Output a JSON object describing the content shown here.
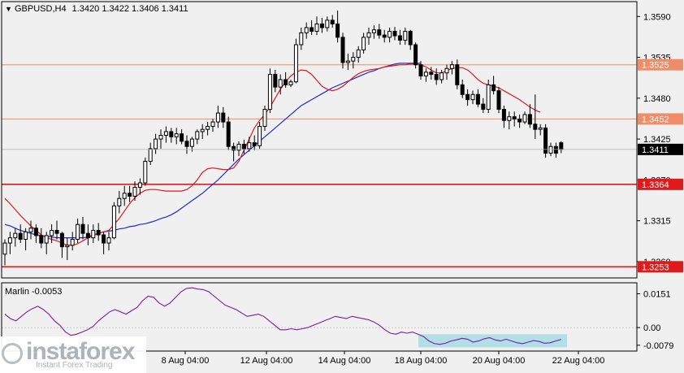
{
  "header": {
    "symbol": "GBPUSD,H4",
    "ohlc": "1.3420 1.3422 1.3406 1.3411"
  },
  "indicator": {
    "name": "Marlin",
    "value": "-0.0053",
    "ticks": [
      "0.0151",
      "0.00",
      "-0.0079"
    ]
  },
  "watermark": {
    "brand": "instaforex",
    "tagline": "Instant Forex Trading"
  },
  "colors": {
    "background": "#f0f0f0",
    "bull_candle": "#ffffff",
    "bear_candle": "#000000",
    "ma_fast": "#e0191e",
    "ma_slow": "#1f2ccc",
    "level_thin": "#f08c68",
    "level_thick": "#e01a1a",
    "price_tag": "#000000",
    "oscillator": "#7c1aa6",
    "highlight_box": "#a8dde4"
  },
  "chart_data": [
    {
      "type": "candlestick",
      "title": "GBPUSD,H4",
      "x_ticks": [
        "8 Aug 04:00",
        "12 Aug 04:00",
        "14 Aug 04:00",
        "18 Aug 04:00",
        "20 Aug 04:00",
        "22 Aug 04:00"
      ],
      "y_ticks": [
        1.359,
        1.3535,
        1.348,
        1.3425,
        1.337,
        1.3315,
        1.326
      ],
      "ylim": [
        1.3238,
        1.361
      ],
      "price_labels": [
        {
          "value": 1.3525,
          "text": "1.3525",
          "style": "thin"
        },
        {
          "value": 1.3452,
          "text": "1.3452",
          "style": "thin"
        },
        {
          "value": 1.3364,
          "text": "1.3364",
          "style": "thick"
        },
        {
          "value": 1.3253,
          "text": "1.3253",
          "style": "thick"
        }
      ],
      "current_price": {
        "value": 1.3411,
        "text": "1.3411"
      },
      "candles_ohlc": [
        [
          1.327,
          1.329,
          1.3255,
          1.3285
        ],
        [
          1.3285,
          1.33,
          1.327,
          1.3292
        ],
        [
          1.3292,
          1.3305,
          1.328,
          1.3298
        ],
        [
          1.3298,
          1.331,
          1.3285,
          1.329
        ],
        [
          1.329,
          1.3305,
          1.3275,
          1.33
        ],
        [
          1.33,
          1.3315,
          1.329,
          1.3305
        ],
        [
          1.3305,
          1.331,
          1.3285,
          1.3295
        ],
        [
          1.3295,
          1.3305,
          1.3278,
          1.3285
        ],
        [
          1.3285,
          1.33,
          1.327,
          1.3295
        ],
        [
          1.3295,
          1.331,
          1.3285,
          1.3302
        ],
        [
          1.3302,
          1.3315,
          1.329,
          1.3298
        ],
        [
          1.3298,
          1.33,
          1.3265,
          1.328
        ],
        [
          1.328,
          1.3292,
          1.3262,
          1.3282
        ],
        [
          1.3282,
          1.33,
          1.3275,
          1.329
        ],
        [
          1.329,
          1.3318,
          1.3285,
          1.331
        ],
        [
          1.331,
          1.332,
          1.329,
          1.3298
        ],
        [
          1.3298,
          1.331,
          1.3282,
          1.3292
        ],
        [
          1.3292,
          1.331,
          1.3285,
          1.3302
        ],
        [
          1.3302,
          1.3312,
          1.3288,
          1.3296
        ],
        [
          1.3296,
          1.33,
          1.327,
          1.3285
        ],
        [
          1.3285,
          1.33,
          1.3275,
          1.3292
        ],
        [
          1.3292,
          1.334,
          1.329,
          1.3335
        ],
        [
          1.3335,
          1.3355,
          1.3325,
          1.3345
        ],
        [
          1.3345,
          1.3362,
          1.3335,
          1.3352
        ],
        [
          1.3352,
          1.3362,
          1.334,
          1.3348
        ],
        [
          1.3348,
          1.3368,
          1.3342,
          1.336
        ],
        [
          1.336,
          1.3372,
          1.335,
          1.3366
        ],
        [
          1.3366,
          1.34,
          1.3362,
          1.3395
        ],
        [
          1.3395,
          1.342,
          1.339,
          1.3412
        ],
        [
          1.3412,
          1.3432,
          1.3405,
          1.3425
        ],
        [
          1.3425,
          1.3438,
          1.3412,
          1.343
        ],
        [
          1.343,
          1.3442,
          1.342,
          1.3435
        ],
        [
          1.3435,
          1.344,
          1.342,
          1.3428
        ],
        [
          1.3428,
          1.344,
          1.3418,
          1.3432
        ],
        [
          1.3432,
          1.3438,
          1.3418,
          1.3422
        ],
        [
          1.3422,
          1.343,
          1.3405,
          1.3415
        ],
        [
          1.3415,
          1.3428,
          1.3408,
          1.3425
        ],
        [
          1.3425,
          1.3438,
          1.3418,
          1.3435
        ],
        [
          1.3435,
          1.3445,
          1.3425,
          1.3438
        ],
        [
          1.3438,
          1.3448,
          1.343,
          1.3442
        ],
        [
          1.3442,
          1.3452,
          1.3435,
          1.3448
        ],
        [
          1.3448,
          1.347,
          1.344,
          1.346
        ],
        [
          1.346,
          1.3468,
          1.344,
          1.3448
        ],
        [
          1.3448,
          1.3455,
          1.341,
          1.3415
        ],
        [
          1.3415,
          1.342,
          1.3395,
          1.341
        ],
        [
          1.341,
          1.3422,
          1.3402,
          1.3418
        ],
        [
          1.3418,
          1.3424,
          1.3405,
          1.3412
        ],
        [
          1.3412,
          1.3428,
          1.3408,
          1.342
        ],
        [
          1.342,
          1.343,
          1.341,
          1.3416
        ],
        [
          1.3416,
          1.3448,
          1.3412,
          1.3442
        ],
        [
          1.3442,
          1.347,
          1.3436,
          1.3465
        ],
        [
          1.3465,
          1.352,
          1.346,
          1.3512
        ],
        [
          1.3512,
          1.3518,
          1.3488,
          1.3495
        ],
        [
          1.3495,
          1.3512,
          1.3485,
          1.3505
        ],
        [
          1.3505,
          1.3515,
          1.3494,
          1.3498
        ],
        [
          1.3498,
          1.3505,
          1.3495,
          1.3502
        ],
        [
          1.3502,
          1.356,
          1.35,
          1.3552
        ],
        [
          1.3552,
          1.3575,
          1.3545,
          1.3568
        ],
        [
          1.3568,
          1.3582,
          1.356,
          1.3575
        ],
        [
          1.3575,
          1.3585,
          1.3565,
          1.357
        ],
        [
          1.357,
          1.359,
          1.3565,
          1.358
        ],
        [
          1.358,
          1.3588,
          1.3568,
          1.3575
        ],
        [
          1.3575,
          1.359,
          1.357,
          1.3585
        ],
        [
          1.3585,
          1.3592,
          1.3575,
          1.358
        ],
        [
          1.358,
          1.3598,
          1.3555,
          1.3562
        ],
        [
          1.3562,
          1.3568,
          1.352,
          1.3528
        ],
        [
          1.3528,
          1.354,
          1.3518,
          1.353
        ],
        [
          1.353,
          1.3542,
          1.352,
          1.3535
        ],
        [
          1.3535,
          1.355,
          1.3528,
          1.3545
        ],
        [
          1.3545,
          1.3568,
          1.354,
          1.3562
        ],
        [
          1.3562,
          1.3575,
          1.3552,
          1.3568
        ],
        [
          1.3568,
          1.3578,
          1.356,
          1.3572
        ],
        [
          1.3572,
          1.358,
          1.356,
          1.3565
        ],
        [
          1.3565,
          1.3572,
          1.3555,
          1.3562
        ],
        [
          1.3562,
          1.3575,
          1.3555,
          1.357
        ],
        [
          1.357,
          1.3576,
          1.3558,
          1.3564
        ],
        [
          1.3564,
          1.3572,
          1.3552,
          1.3558
        ],
        [
          1.3558,
          1.3575,
          1.3552,
          1.357
        ],
        [
          1.357,
          1.3572,
          1.3545,
          1.3552
        ],
        [
          1.3552,
          1.3555,
          1.352,
          1.3525
        ],
        [
          1.3525,
          1.353,
          1.3505,
          1.351
        ],
        [
          1.351,
          1.352,
          1.3502,
          1.3515
        ],
        [
          1.3515,
          1.3522,
          1.3505,
          1.3512
        ],
        [
          1.3512,
          1.352,
          1.3498,
          1.3505
        ],
        [
          1.3505,
          1.3518,
          1.35,
          1.3514
        ],
        [
          1.3514,
          1.3525,
          1.3505,
          1.352
        ],
        [
          1.352,
          1.353,
          1.3512,
          1.3525
        ],
        [
          1.3525,
          1.3532,
          1.3492,
          1.3498
        ],
        [
          1.3498,
          1.3505,
          1.348,
          1.3485
        ],
        [
          1.3485,
          1.3492,
          1.347,
          1.3478
        ],
        [
          1.3478,
          1.349,
          1.3472,
          1.3485
        ],
        [
          1.3485,
          1.3492,
          1.3468,
          1.3472
        ],
        [
          1.3472,
          1.348,
          1.346,
          1.3465
        ],
        [
          1.3465,
          1.3505,
          1.346,
          1.3498
        ],
        [
          1.3498,
          1.351,
          1.3485,
          1.349
        ],
        [
          1.349,
          1.3495,
          1.346,
          1.3465
        ],
        [
          1.3465,
          1.347,
          1.344,
          1.345
        ],
        [
          1.345,
          1.3462,
          1.3438,
          1.3455
        ],
        [
          1.3455,
          1.3462,
          1.3442,
          1.3452
        ],
        [
          1.3452,
          1.3458,
          1.344,
          1.3448
        ],
        [
          1.3448,
          1.3462,
          1.3445,
          1.3458
        ],
        [
          1.3458,
          1.3472,
          1.344,
          1.3445
        ],
        [
          1.3445,
          1.3485,
          1.3425,
          1.3438
        ],
        [
          1.3438,
          1.3445,
          1.343,
          1.344
        ],
        [
          1.344,
          1.3445,
          1.34,
          1.3406
        ],
        [
          1.3406,
          1.342,
          1.3402,
          1.3415
        ],
        [
          1.3415,
          1.342,
          1.34,
          1.3406
        ],
        [
          1.342,
          1.3422,
          1.3406,
          1.3411
        ]
      ],
      "ma_fast": [
        1.3345,
        1.3338,
        1.333,
        1.3322,
        1.3315,
        1.3308,
        1.3302,
        1.3296,
        1.3292,
        1.329,
        1.3288,
        1.3285,
        1.3282,
        1.3282,
        1.3284,
        1.3288,
        1.3292,
        1.3295,
        1.3298,
        1.33,
        1.3302,
        1.331,
        1.3318,
        1.3328,
        1.3338,
        1.3346,
        1.3352,
        1.3356,
        1.3357,
        1.3357,
        1.3356,
        1.3355,
        1.3355,
        1.3355,
        1.3355,
        1.3357,
        1.3362,
        1.337,
        1.338,
        1.3385,
        1.3386,
        1.3385,
        1.3384,
        1.3384,
        1.3386,
        1.3395,
        1.341,
        1.3425,
        1.344,
        1.345,
        1.3458,
        1.3468,
        1.348,
        1.3492,
        1.3502,
        1.351,
        1.3515,
        1.3518,
        1.3517,
        1.3512,
        1.3504,
        1.3496,
        1.3492,
        1.349,
        1.3492,
        1.3496,
        1.3502,
        1.3508,
        1.3513,
        1.3516,
        1.3518,
        1.3519,
        1.352,
        1.3522,
        1.3523,
        1.3524,
        1.3525,
        1.3525,
        1.3526,
        1.3526,
        1.3525,
        1.3522,
        1.3518,
        1.3514,
        1.3514,
        1.3517,
        1.352,
        1.3521,
        1.3521,
        1.3518,
        1.3512,
        1.3505,
        1.35,
        1.3498,
        1.3496,
        1.3494,
        1.349,
        1.3486,
        1.3482,
        1.3478,
        1.3473,
        1.3468,
        1.3464,
        1.3461
      ],
      "ma_slow": [
        1.331,
        1.3308,
        1.3305,
        1.3302,
        1.33,
        1.3298,
        1.3296,
        1.3295,
        1.3294,
        1.3293,
        1.3292,
        1.3292,
        1.3292,
        1.3292,
        1.3292,
        1.3292,
        1.3293,
        1.3296,
        1.3298,
        1.33,
        1.3301,
        1.3302,
        1.3304,
        1.3305,
        1.3307,
        1.3308,
        1.331,
        1.3311,
        1.3313,
        1.3315,
        1.3318,
        1.332,
        1.3323,
        1.3327,
        1.3332,
        1.3337,
        1.3342,
        1.3347,
        1.3352,
        1.3358,
        1.3364,
        1.337,
        1.3377,
        1.3384,
        1.3391,
        1.3398,
        1.3404,
        1.341,
        1.3416,
        1.3422,
        1.3428,
        1.3434,
        1.344,
        1.3446,
        1.3452,
        1.3458,
        1.3464,
        1.347,
        1.3474,
        1.3478,
        1.3482,
        1.3486,
        1.349,
        1.3494,
        1.3497,
        1.35,
        1.3503,
        1.3506,
        1.3509,
        1.3512,
        1.3515,
        1.3517,
        1.352,
        1.3522,
        1.3524,
        1.3526,
        1.3527,
        1.3527,
        1.3527,
        1.3527,
        1.3527
      ]
    },
    {
      "type": "line",
      "title": "Marlin -0.0053",
      "y_ticks": [
        0.0151,
        0.0,
        -0.0079
      ],
      "ylim": [
        -0.0105,
        0.02
      ],
      "values": [
        0.006,
        0.004,
        0.003,
        0.005,
        0.007,
        0.0085,
        0.0095,
        0.008,
        0.006,
        0.003,
        0.001,
        -0.002,
        -0.0035,
        -0.003,
        -0.002,
        -0.001,
        0.0005,
        0.003,
        0.005,
        0.007,
        0.008,
        0.007,
        0.006,
        0.0075,
        0.009,
        0.012,
        0.014,
        0.0135,
        0.011,
        0.0095,
        0.011,
        0.0135,
        0.016,
        0.0175,
        0.0178,
        0.0172,
        0.017,
        0.016,
        0.014,
        0.012,
        0.01,
        0.009,
        0.008,
        0.0065,
        0.005,
        0.0055,
        0.006,
        0.005,
        0.003,
        0.001,
        -0.001,
        -0.001,
        -0.0005,
        -0.001,
        -0.0005,
        0.0,
        0.001,
        0.002,
        0.003,
        0.004,
        0.005,
        0.0045,
        0.004,
        0.005,
        0.0045,
        0.004,
        0.0035,
        0.0025,
        0.001,
        -0.001,
        -0.0025,
        -0.003,
        -0.002,
        -0.0025,
        -0.002,
        -0.003,
        -0.004,
        -0.006,
        -0.0072,
        -0.0075,
        -0.007,
        -0.006,
        -0.0055,
        -0.0048,
        -0.0052,
        -0.0065,
        -0.006,
        -0.005,
        -0.0045,
        -0.0055,
        -0.006,
        -0.0052,
        -0.006,
        -0.0068,
        -0.0072,
        -0.0065,
        -0.0058,
        -0.0062,
        -0.007,
        -0.0068,
        -0.006,
        -0.0053
      ]
    }
  ]
}
